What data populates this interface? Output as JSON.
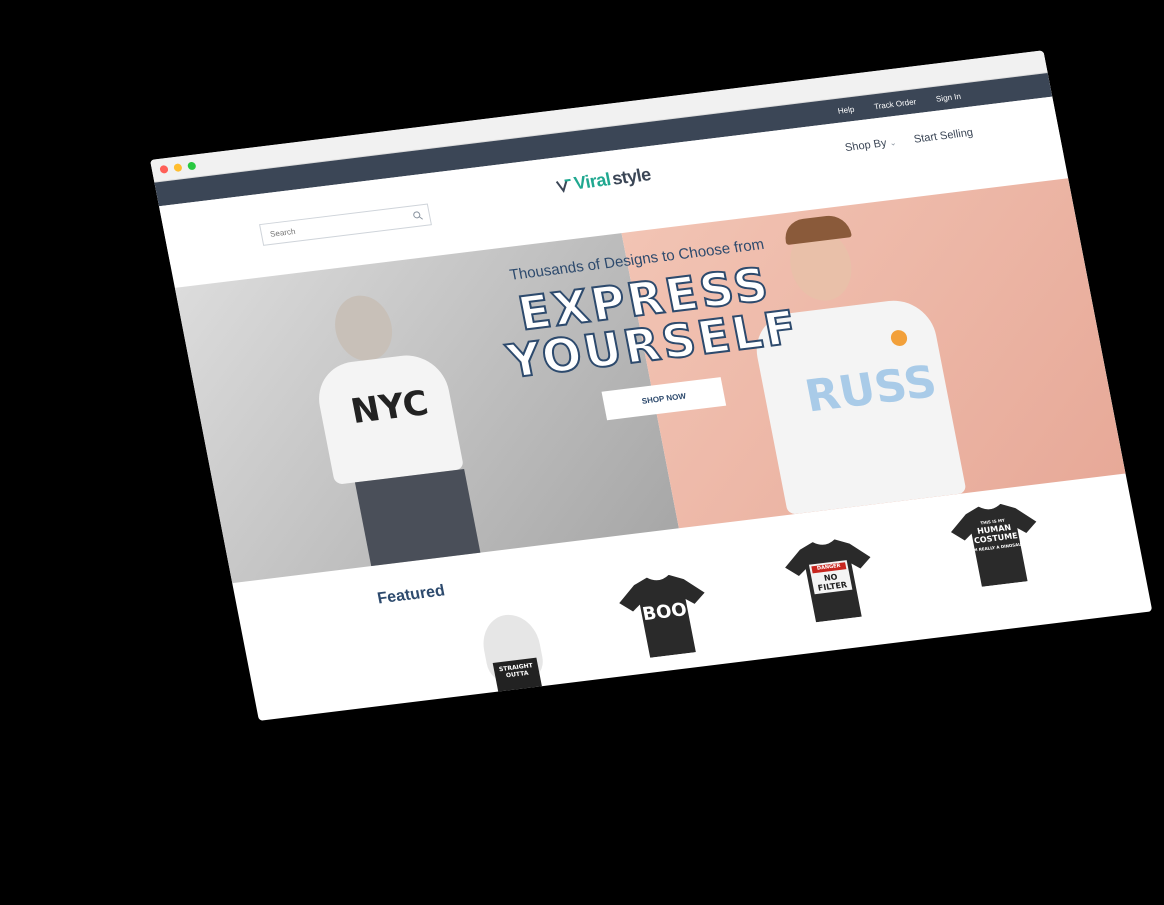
{
  "topbar": {
    "links": [
      "Help",
      "Track Order",
      "Sign In"
    ]
  },
  "header": {
    "search_placeholder": "Search",
    "logo_prefix": "Viral",
    "logo_suffix": "style",
    "nav": {
      "shop_by": "Shop By",
      "start_selling": "Start Selling"
    }
  },
  "hero": {
    "subtitle": "Thousands of Designs to Choose from",
    "title_line1": "EXPRESS",
    "title_line2": "YOURSELF",
    "button": "SHOP NOW",
    "left_tee_text": "NYC",
    "right_tee_text": "RUSS"
  },
  "featured": {
    "heading": "Featured",
    "products": [
      {
        "label": "STRAIGHT OUTTA"
      },
      {
        "label": "BOO"
      },
      {
        "label_top": "DANGER",
        "label": "NO FILTER"
      },
      {
        "label_small": "THIS IS MY",
        "label": "HUMAN COSTUME",
        "label_bottom": "I'M REALLY A DINOSAUR"
      }
    ]
  },
  "colors": {
    "accent": "#2d4a6d",
    "topbar": "#3b4656",
    "logo_green": "#20a890"
  }
}
